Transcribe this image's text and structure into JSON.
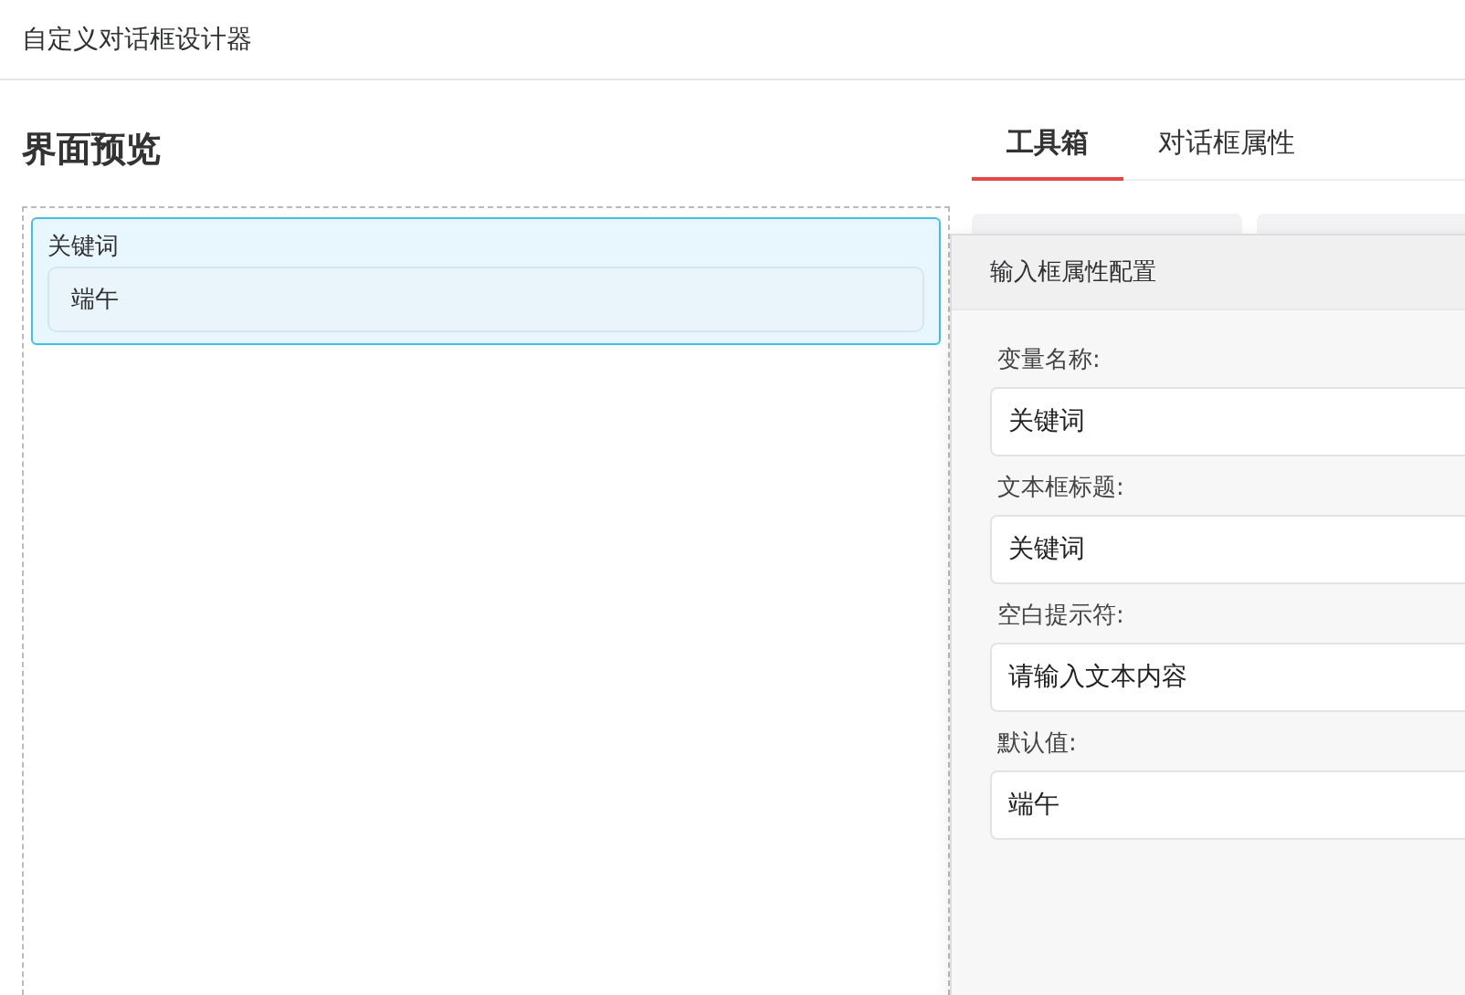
{
  "window": {
    "title": "自定义对话框设计器"
  },
  "preview": {
    "title": "界面预览",
    "items": [
      {
        "label": "关键词",
        "value": "端午",
        "selected": true
      }
    ]
  },
  "tabs": [
    {
      "label": "工具箱",
      "selected": true
    },
    {
      "label": "对话框属性",
      "selected": false
    }
  ],
  "popover": {
    "title": "输入框属性配置",
    "fields": [
      {
        "label": "变量名称:",
        "value": "关键词"
      },
      {
        "label": "文本框标题:",
        "value": "关键词"
      },
      {
        "label": "空白提示符:",
        "value": "请输入文本内容"
      },
      {
        "label": "默认值:",
        "value": "端午"
      }
    ]
  }
}
